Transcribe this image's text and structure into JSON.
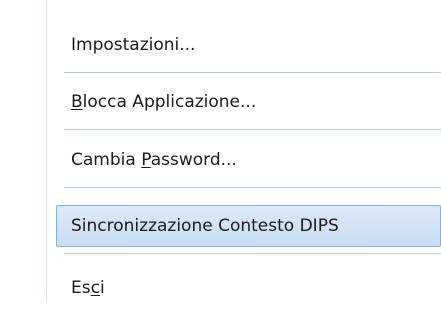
{
  "menu": {
    "items": [
      {
        "pre": "Impostazioni...",
        "accel": "",
        "post": ""
      },
      {
        "pre": "",
        "accel": "B",
        "post": "locca Applicazione..."
      },
      {
        "pre": "Cambia ",
        "accel": "P",
        "post": "assword..."
      },
      {
        "pre": "Sincronizzazione Contesto DIPS",
        "accel": "",
        "post": ""
      },
      {
        "pre": "Es",
        "accel": "c",
        "post": "i"
      }
    ]
  }
}
